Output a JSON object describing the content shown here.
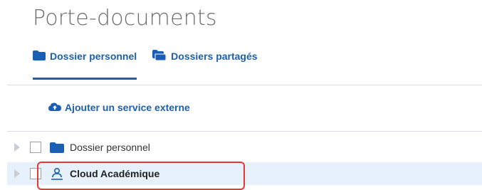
{
  "page": {
    "title": "Porte-documents"
  },
  "tabs": [
    {
      "label": "Dossier personnel",
      "icon": "folder-icon",
      "active": true
    },
    {
      "label": "Dossiers partagés",
      "icon": "folders-icon",
      "active": false
    }
  ],
  "actions": {
    "add_service_label": "Ajouter un service externe",
    "add_service_icon": "cloud-upload-icon"
  },
  "tree": {
    "items": [
      {
        "label": "Dossier personnel",
        "icon": "folder-icon",
        "selected": false
      },
      {
        "label": "Cloud Académique",
        "icon": "cloud-user-icon",
        "selected": true
      }
    ]
  },
  "colors": {
    "accent": "#1a5fb4",
    "link": "#1f5fa8",
    "row_highlight": "#e7f1fb",
    "annotation_border": "#e53935"
  }
}
